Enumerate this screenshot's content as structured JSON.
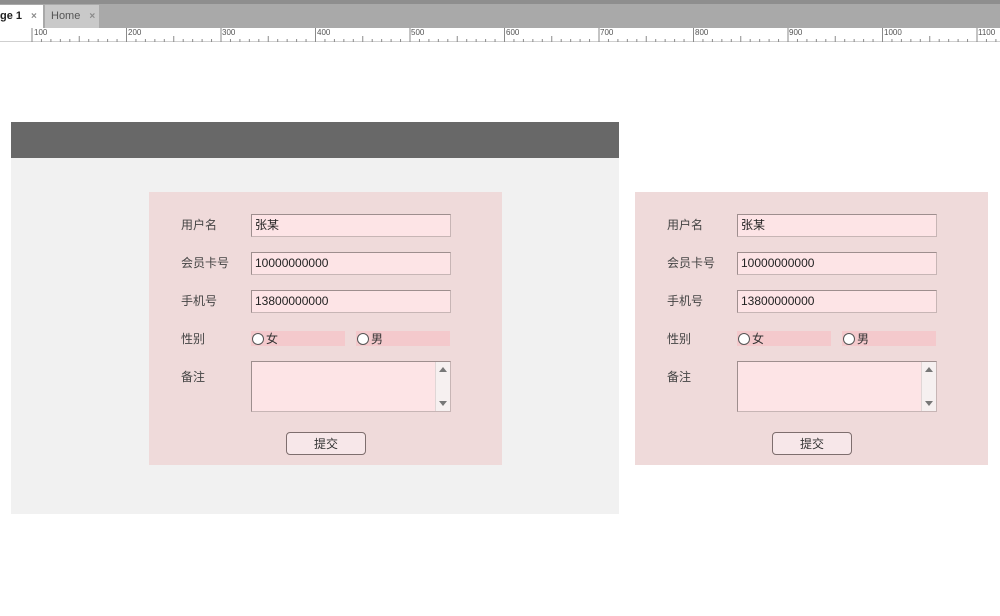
{
  "tabs": [
    {
      "label": "ge 1",
      "close": "×"
    },
    {
      "label": "Home",
      "close": "×"
    }
  ],
  "ruler": {
    "labels": [
      "100",
      "200",
      "300",
      "400",
      "500",
      "600",
      "700",
      "800",
      "900",
      "1000",
      "1100"
    ]
  },
  "form_left": {
    "username_label": "用户名",
    "username_value": "张某",
    "card_label": "会员卡号",
    "card_value": "10000000000",
    "phone_label": "手机号",
    "phone_value": "13800000000",
    "gender_label": "性别",
    "gender_female": "女",
    "gender_male": "男",
    "notes_label": "备注",
    "notes_value": "",
    "submit_label": "提交"
  },
  "form_right": {
    "username_label": "用户名",
    "username_value": "张某",
    "card_label": "会员卡号",
    "card_value": "10000000000",
    "phone_label": "手机号",
    "phone_value": "13800000000",
    "gender_label": "性别",
    "gender_female": "女",
    "gender_male": "男",
    "notes_label": "备注",
    "notes_value": "",
    "submit_label": "提交"
  },
  "colors": {
    "card_bg": "#efdada",
    "field_bg": "#fde4e6",
    "radio_bg": "#f4c9cc",
    "header_bg": "#686868",
    "panel_bg": "#f1f1f1"
  }
}
